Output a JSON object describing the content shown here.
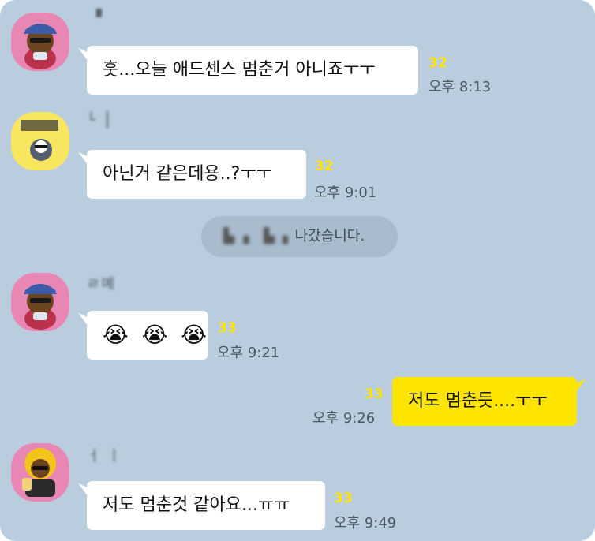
{
  "messages": [
    {
      "sender": "▘",
      "text": "훗...오늘 애드센스 멈춘거 아니죠ㅜㅜ",
      "unread": "32",
      "time": "오후 8:13"
    },
    {
      "sender": "└▕",
      "text": "아닌거 같은데용..?ㅜㅜ",
      "unread": "32",
      "time": "오후 9:01"
    },
    {
      "sender": "ㄹ몌",
      "text": "😭 😭 😭",
      "unread": "33",
      "time": "오후 9:21"
    },
    {
      "text": "저도 멈춘듯....ㅜㅜ",
      "unread": "33",
      "time": "오후 9:26"
    },
    {
      "sender": "ㅓ ㅣ",
      "text": "저도 멈춘것 같아요...ㅠㅠ",
      "unread": "33",
      "time": "오후 9:49"
    }
  ],
  "notice": {
    "who": "▙ ▖ ▙▗",
    "text": "나갔습니다."
  },
  "colors": {
    "background": "#b9cddf",
    "my_bubble": "#fee500",
    "other_bubble": "#ffffff",
    "unread": "#fee500"
  }
}
